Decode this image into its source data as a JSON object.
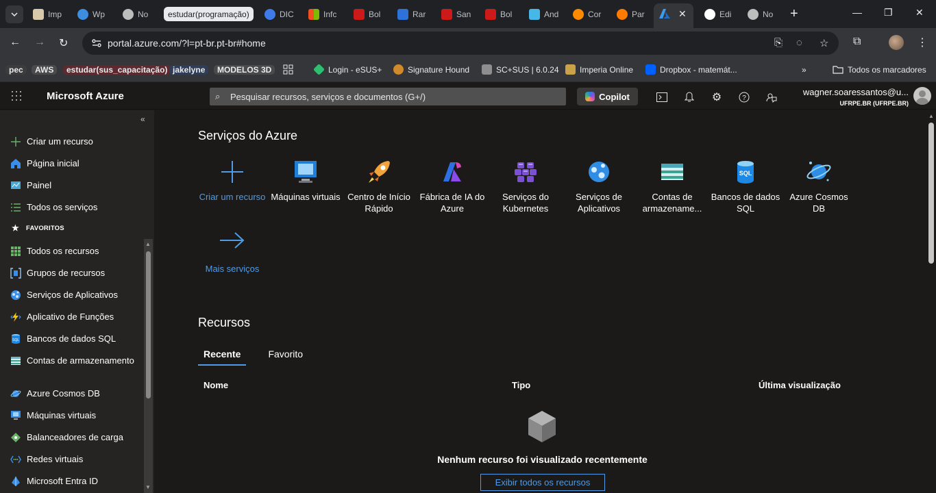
{
  "browser": {
    "tabs": [
      {
        "title": "Imp",
        "fav": "#d7c9a9"
      },
      {
        "title": "Wp",
        "fav": "#3c8ee0"
      },
      {
        "title": "No",
        "fav": "#bdbdbd"
      },
      {
        "title": "DIC",
        "fav": "#3f7be8"
      },
      {
        "title": "Infc",
        "fav": "#f25022"
      },
      {
        "title": "Bol",
        "fav": "#cc1a1a"
      },
      {
        "title": "Rar",
        "fav": "#2d72d9"
      },
      {
        "title": "San",
        "fav": "#cc1a1a"
      },
      {
        "title": "Bol",
        "fav": "#cc1a1a"
      },
      {
        "title": "And",
        "fav": "#45b8e8"
      },
      {
        "title": "Cor",
        "fav": "#ff8a00"
      },
      {
        "title": "Par",
        "fav": "#ff7a00"
      },
      {
        "title": "Edi",
        "fav": "#ffffff"
      },
      {
        "title": "No",
        "fav": "#bdbdbd"
      }
    ],
    "tab_group_label": "estudar(programação)",
    "url": "portal.azure.com/?l=pt-br.pt-br#home",
    "bookmarks": [
      {
        "label": "pec",
        "chip": "#3c3c3c"
      },
      {
        "label": "AWS",
        "chip": "#4a4a4a"
      },
      {
        "label": "estudar(sus_capacitação)",
        "chip": "#5c2a2f"
      },
      {
        "label": "jakelyne",
        "chip": "#2f3d57"
      },
      {
        "label": "MODELOS 3D",
        "chip": "#4a4a4a"
      },
      {
        "label": "Login - eSUS+",
        "icon": "#2fbf71"
      },
      {
        "label": "Signature Hound",
        "icon": "#d08a2c"
      },
      {
        "label": "SC+SUS | 6.0.24",
        "icon": "#8e8e8e"
      },
      {
        "label": "Imperia Online",
        "icon": "#c9a24a"
      },
      {
        "label": "Dropbox - matemát...",
        "icon": "#0061fe"
      }
    ],
    "all_bookmarks_label": "Todos os marcadores"
  },
  "azure": {
    "brand": "Microsoft Azure",
    "search_placeholder": "Pesquisar recursos, serviços e documentos (G+/)",
    "copilot_label": "Copilot",
    "account_name": "wagner.soaressantos@u...",
    "account_directory": "UFRPE.BR (UFRPE.BR)"
  },
  "leftnav": {
    "create": "Criar um recurso",
    "home": "Página inicial",
    "dashboard": "Painel",
    "all_services": "Todos os serviços",
    "favorites_header": "FAVORITOS",
    "favorites": [
      "Todos os recursos",
      "Grupos de recursos",
      "Serviços de Aplicativos",
      "Aplicativo de Funções",
      "Bancos de dados SQL",
      "Contas de armazenamento",
      "Azure Cosmos DB",
      "Máquinas virtuais",
      "Balanceadores de carga",
      "Redes virtuais",
      "Microsoft Entra ID"
    ]
  },
  "main": {
    "services_title": "Serviços do Azure",
    "services": [
      {
        "label": "Criar um recurso",
        "icon": "plus-icon"
      },
      {
        "label": "Máquinas virtuais",
        "icon": "vm-icon"
      },
      {
        "label": "Centro de Início Rápido",
        "icon": "rocket-icon"
      },
      {
        "label": "Fábrica de IA do Azure",
        "icon": "ai-foundry-icon"
      },
      {
        "label": "Serviços do Kubernetes",
        "icon": "kubernetes-icon"
      },
      {
        "label": "Serviços de Aplicativos",
        "icon": "app-service-icon"
      },
      {
        "label": "Contas de armazename...",
        "icon": "storage-icon"
      },
      {
        "label": "Bancos de dados SQL",
        "icon": "sql-icon"
      },
      {
        "label": "Azure Cosmos DB",
        "icon": "cosmos-icon"
      }
    ],
    "more_services": "Mais serviços",
    "resources_title": "Recursos",
    "tabs": [
      "Recente",
      "Favorito"
    ],
    "columns": [
      "Nome",
      "Tipo",
      "Última visualização"
    ],
    "empty_text": "Nenhum recurso foi visualizado recentemente",
    "view_all_button": "Exibir todos os recursos"
  },
  "colors": {
    "accent": "#4f9ce8",
    "nav_bg": "#252423",
    "content_bg": "#1b1a19"
  }
}
